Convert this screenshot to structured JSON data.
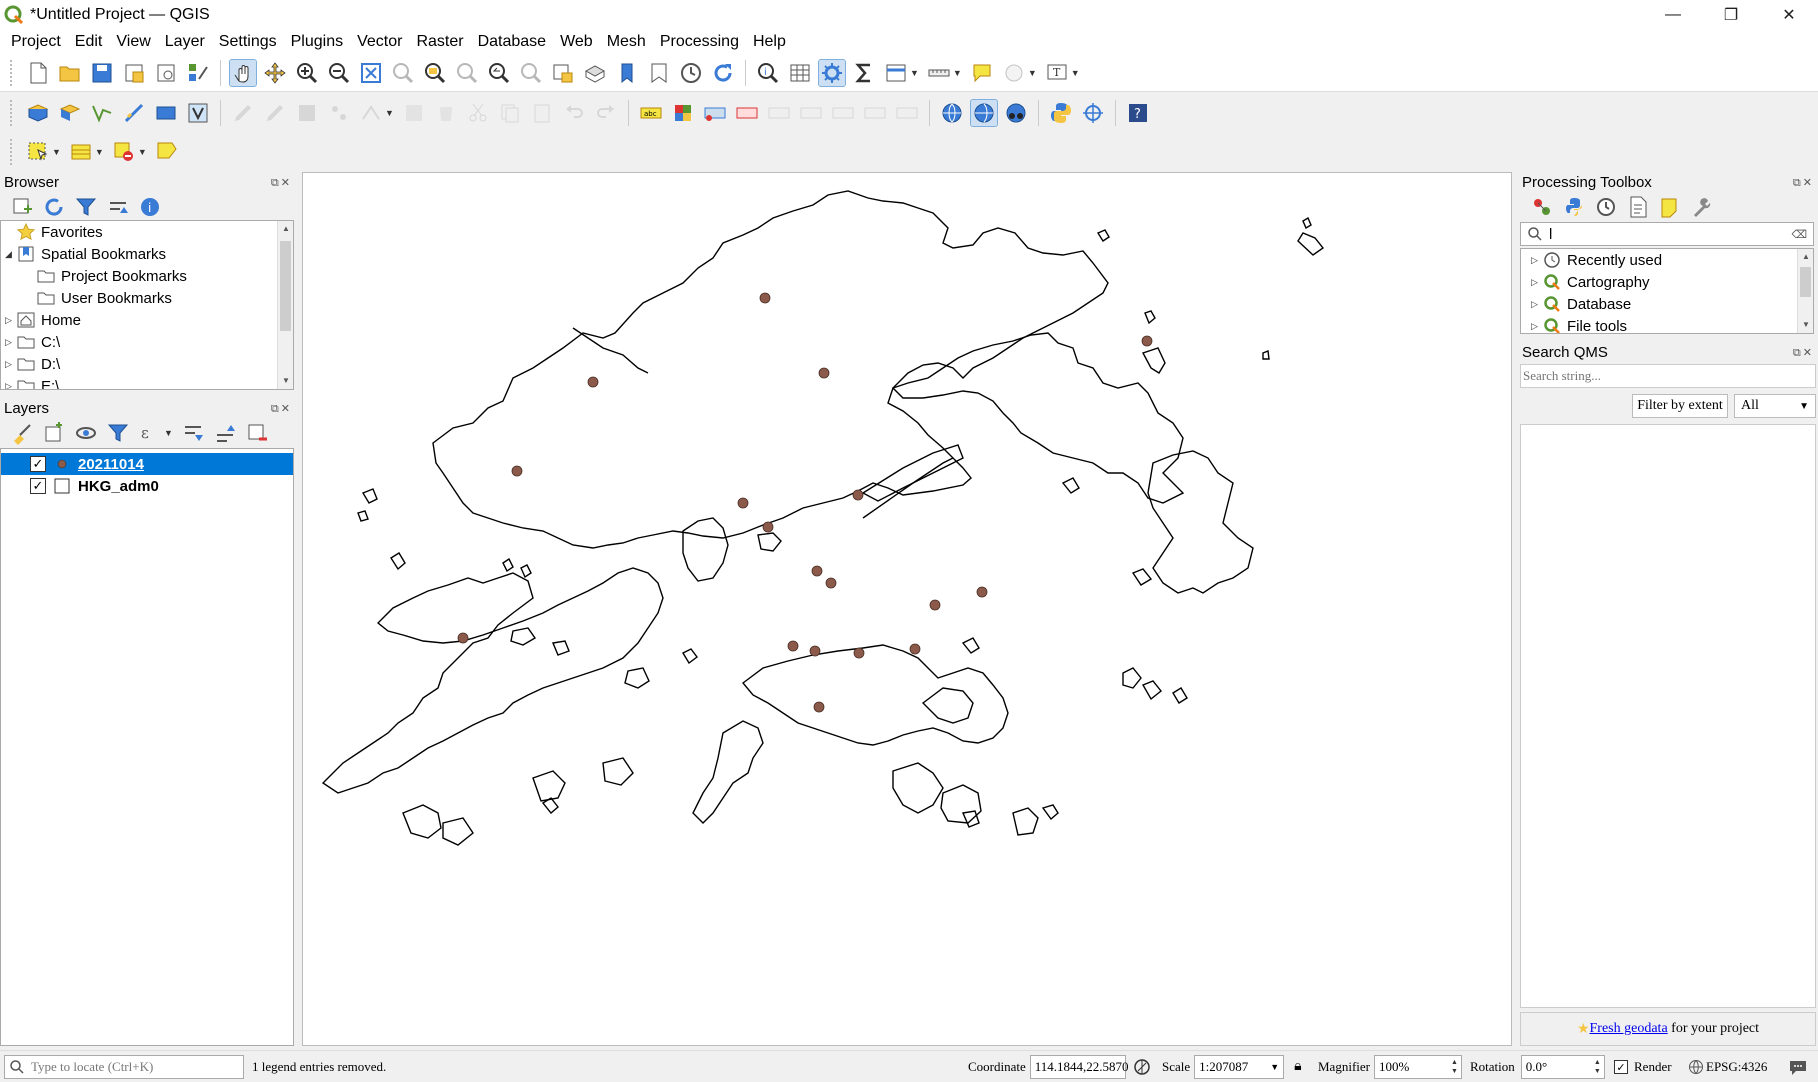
{
  "window": {
    "title": "*Untitled Project — QGIS",
    "minimize": "—",
    "maximize": "❐",
    "close": "✕"
  },
  "menubar": {
    "items": [
      {
        "label": "Project",
        "mnemonic": "P"
      },
      {
        "label": "Edit",
        "mnemonic": "E"
      },
      {
        "label": "View",
        "mnemonic": "V"
      },
      {
        "label": "Layer",
        "mnemonic": "L"
      },
      {
        "label": "Settings",
        "mnemonic": "S"
      },
      {
        "label": "Plugins",
        "mnemonic": "P"
      },
      {
        "label": "Vector",
        "mnemonic": "o"
      },
      {
        "label": "Raster",
        "mnemonic": "R"
      },
      {
        "label": "Database",
        "mnemonic": "D"
      },
      {
        "label": "Web",
        "mnemonic": "W"
      },
      {
        "label": "Mesh",
        "mnemonic": "M"
      },
      {
        "label": "Processing",
        "mnemonic": "P"
      },
      {
        "label": "Help",
        "mnemonic": "H"
      }
    ]
  },
  "browser": {
    "title": "Browser",
    "items": [
      {
        "label": "Favorites",
        "icon": "star-icon",
        "expandable": false
      },
      {
        "label": "Spatial Bookmarks",
        "icon": "bookmarks-icon",
        "expandable": true,
        "expanded": true
      },
      {
        "label": "Project Bookmarks",
        "icon": "folder-icon",
        "child": true
      },
      {
        "label": "User Bookmarks",
        "icon": "folder-icon",
        "child": true
      },
      {
        "label": "Home",
        "icon": "home-icon",
        "expandable": true
      },
      {
        "label": "C:\\",
        "icon": "folder-icon",
        "expandable": true
      },
      {
        "label": "D:\\",
        "icon": "folder-icon",
        "expandable": true
      },
      {
        "label": "E:\\",
        "icon": "folder-icon",
        "expandable": true
      }
    ]
  },
  "layers": {
    "title": "Layers",
    "items": [
      {
        "name": "20211014",
        "checked": true,
        "selected": true,
        "symbol": "point"
      },
      {
        "name": "HKG_adm0",
        "checked": true,
        "selected": false,
        "symbol": "polygon"
      }
    ]
  },
  "processing_toolbox": {
    "title": "Processing Toolbox",
    "search_value": "l",
    "items": [
      {
        "label": "Recently used",
        "icon": "clock-icon"
      },
      {
        "label": "Cartography",
        "icon": "qgis-icon"
      },
      {
        "label": "Database",
        "icon": "qgis-icon"
      },
      {
        "label": "File tools",
        "icon": "qgis-icon"
      }
    ]
  },
  "qms": {
    "title": "Search QMS",
    "placeholder": "Search string...",
    "filter_button": "Filter by extent",
    "select_value": "All",
    "footer_link": "Fresh geodata",
    "footer_text": " for your project"
  },
  "map": {
    "outline_color": "#000000",
    "point_color": "#8b5a4a"
  },
  "statusbar": {
    "locate_placeholder": "Type to locate (Ctrl+K)",
    "message": "1 legend entries removed.",
    "coordinate_label": "Coordinate",
    "coordinate_value": "114.1844,22.5870",
    "scale_label": "Scale",
    "scale_value": "1:207087",
    "magnifier_label": "Magnifier",
    "magnifier_value": "100%",
    "rotation_label": "Rotation",
    "rotation_value": "0.0°",
    "render_label": "Render",
    "crs": "EPSG:4326"
  },
  "colors": {
    "selection": "#0078d7",
    "accent_green": "#589632"
  }
}
